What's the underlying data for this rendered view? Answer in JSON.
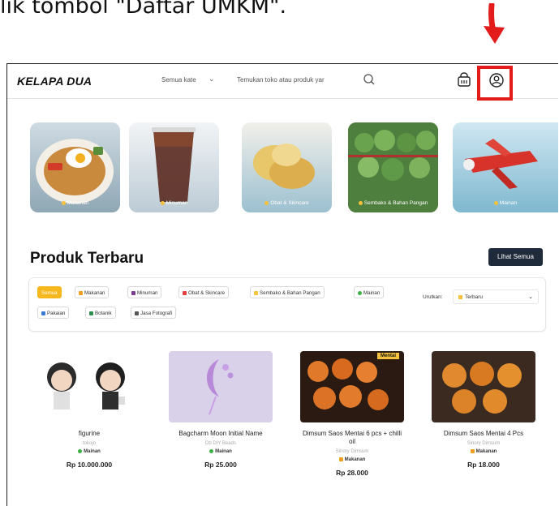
{
  "instruction": "lik tombol \"Daftar UMKM\".",
  "header": {
    "logo": "KELAPA DUA",
    "category_select": "Semua kate",
    "search_placeholder": "Temukan toko atau produk yar",
    "icons": [
      "search-icon",
      "cart-icon",
      "user-icon"
    ]
  },
  "categories": [
    {
      "label": "Makanan",
      "color": "#b9c9d3"
    },
    {
      "label": "Minuman",
      "color": "#c7d3dc"
    },
    {
      "label": "Obat & Skincare",
      "color": "#d6e2ea"
    },
    {
      "label": "Sembako & Bahan Pangan",
      "color": "#5e8c4f"
    },
    {
      "label": "Mainan",
      "color": "#a8d2e6"
    }
  ],
  "section": {
    "title": "Produk Terbaru",
    "see_all": "Lihat Semua"
  },
  "filters": {
    "chips": [
      "Semua",
      "Makanan",
      "Minuman",
      "Obat & Skincare",
      "Sembako & Bahan Pangan",
      "Mainan",
      "Pakaian",
      "Botanik",
      "Jasa Fotografi"
    ],
    "active": "Semua",
    "sort_label": "Urutkan:",
    "sort_value": "Terbaru"
  },
  "products": [
    {
      "name": "figurine",
      "store": "tokojo",
      "category": "Mainan",
      "price": "Rp 10.000.000"
    },
    {
      "name": "Bagcharm Moon Initial Name",
      "store": "Db DIY Beads",
      "category": "Mainan",
      "price": "Rp 25.000"
    },
    {
      "name": "Dimsum Saos Mentai 6 pcs + chilli oil",
      "store": "Sinory Dimsum",
      "category": "Makanan",
      "price": "Rp 28.000",
      "badge": "Mentai"
    },
    {
      "name": "Dimsum Saos Mentai 4 Pcs",
      "store": "Sinory Dimsum",
      "category": "Makanan",
      "price": "Rp 18.000"
    }
  ],
  "colors": {
    "accent": "#f6b81d",
    "dark_button": "#1f2a3a",
    "highlight": "#e31b1b"
  }
}
